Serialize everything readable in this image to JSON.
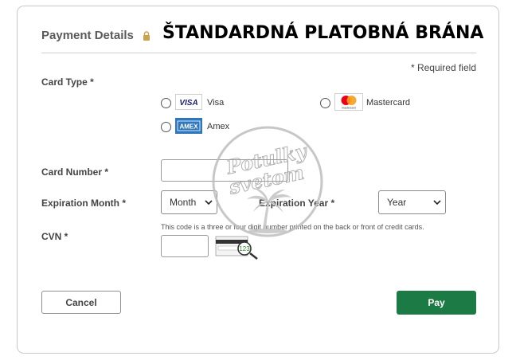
{
  "header": {
    "title": "Payment Details",
    "overlay_title": "ŠTANDARDNÁ PLATOBNÁ BRÁNA"
  },
  "required_note": "* Required field",
  "card_type": {
    "label": "Card Type *",
    "options": [
      {
        "label": "Visa",
        "logo_text": "VISA"
      },
      {
        "label": "Mastercard",
        "logo_text": "mastercard"
      },
      {
        "label": "Amex",
        "logo_text": "AMEX"
      }
    ]
  },
  "card_number": {
    "label": "Card Number *",
    "value": ""
  },
  "expiration_month": {
    "label": "Expiration Month *",
    "selected": "Month"
  },
  "expiration_year": {
    "label": "Expiration Year *",
    "selected": "Year"
  },
  "cvn": {
    "label": "CVN *",
    "hint": "This code is a three or four digit number printed on the back or front of credit cards.",
    "value": "",
    "example_digits": "123"
  },
  "buttons": {
    "cancel": "Cancel",
    "pay": "Pay"
  },
  "watermark": {
    "line1": "Potulky",
    "line2": "svetom"
  },
  "colors": {
    "pay_button": "#1c7a45",
    "visa_blue": "#1a1f71",
    "amex_blue": "#2e77bc",
    "mc_red": "#eb001b",
    "mc_orange": "#f79e1b"
  }
}
